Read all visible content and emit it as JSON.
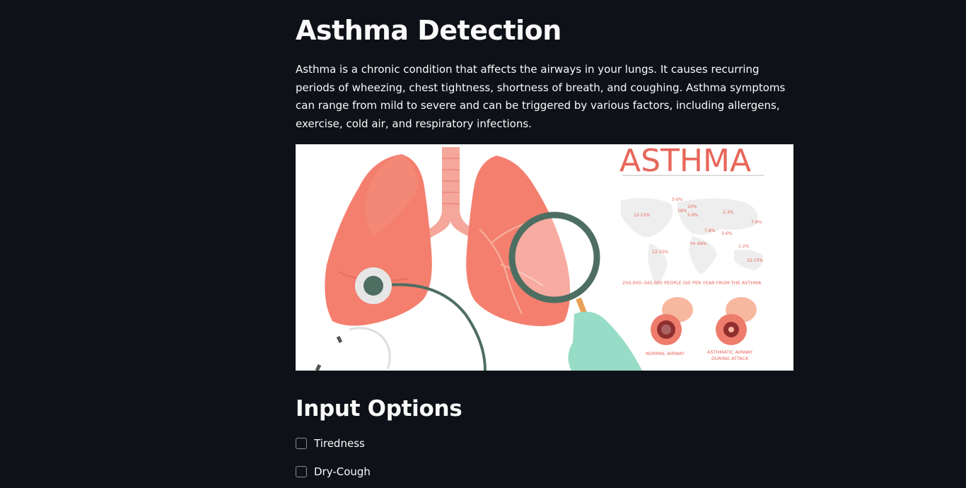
{
  "page": {
    "title": "Asthma Detection",
    "intro": "Asthma is a chronic condition that affects the airways in your lungs. It causes recurring periods of wheezing, chest tightness, shortness of breath, and coughing. Asthma symptoms can range from mild to severe and can be triggered by various factors, including allergens, exercise, cold air, and respiratory infections."
  },
  "hero": {
    "heading": "ASTHMA",
    "map_labels": [
      "5-9%",
      "10%",
      "18%",
      "5-9%",
      "12-15%",
      "2-3%",
      "7-8%",
      "7-8%",
      "3-6%",
      "no data",
      "1-2%",
      "12-15%",
      "12-15%"
    ],
    "caption": "250,000–345,000 PEOPLE DIE PER YEAR FROM THE ASTHMA",
    "airway_normal": "NORMAL AIRWAY",
    "airway_asthmatic_line1": "ASTHMATIC AIRWAY",
    "airway_asthmatic_line2": "DURING ATTACK"
  },
  "input_options": {
    "title": "Input Options",
    "items": [
      {
        "label": "Tiredness",
        "checked": false
      },
      {
        "label": "Dry-Cough",
        "checked": false
      }
    ]
  },
  "colors": {
    "background": "#0e1117",
    "text": "#fafafa",
    "lung": "#f47f6e",
    "accent": "#e8665a",
    "glove": "#97dcc6",
    "instrument": "#4e6e62"
  }
}
